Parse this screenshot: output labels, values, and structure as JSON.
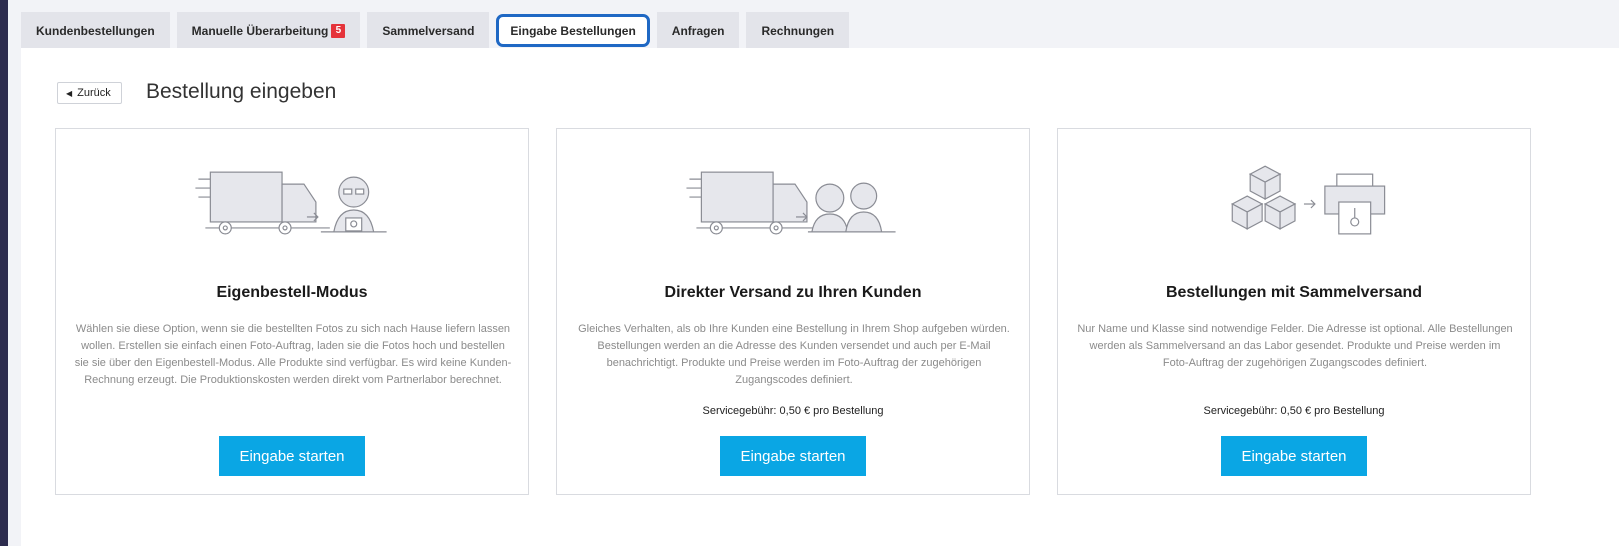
{
  "tabs": [
    {
      "label": "Kundenbestellungen"
    },
    {
      "label": "Manuelle Überarbeitung",
      "badge": "5"
    },
    {
      "label": "Sammelversand"
    },
    {
      "label": "Eingabe Bestellungen"
    },
    {
      "label": "Anfragen"
    },
    {
      "label": "Rechnungen"
    }
  ],
  "active_tab": "Eingabe Bestellungen",
  "back_label": "Zurück",
  "page_title": "Bestellung eingeben",
  "cards": [
    {
      "title": "Eigenbestell-Modus",
      "description": "Wählen sie diese Option, wenn sie die bestellten Fotos zu sich nach Hause liefern lassen wollen. Erstellen sie einfach einen Foto-Auftrag, laden sie die Fotos hoch und bestellen sie sie über den Eigenbestell-Modus. Alle Produkte sind verfügbar. Es wird keine Kunden-Rechnung erzeugt. Die Produktionskosten werden direkt vom Partnerlabor berechnet.",
      "fee": "",
      "button": "Eingabe starten",
      "icon": "truck-to-photographer-icon"
    },
    {
      "title": "Direkter Versand zu Ihren Kunden",
      "description": "Gleiches Verhalten, als ob Ihre Kunden eine Bestellung in Ihrem Shop aufgeben würden. Bestellungen werden an die Adresse des Kunden versendet und auch per E-Mail benachrichtigt. Produkte und Preise werden im Foto-Auftrag der zugehörigen Zugangscodes definiert.",
      "fee": "Servicegebühr: 0,50 € pro Bestellung",
      "button": "Eingabe starten",
      "icon": "truck-to-customers-icon"
    },
    {
      "title": "Bestellungen mit Sammelversand",
      "description": "Nur Name und Klasse sind notwendige Felder. Die Adresse ist optional. Alle Bestellungen werden als Sammelversand an das Labor gesendet. Produkte und Preise werden im Foto-Auftrag der zugehörigen Zugangscodes definiert.",
      "fee": "Servicegebühr: 0,50 € pro Bestellung",
      "button": "Eingabe starten",
      "icon": "boxes-to-printer-icon"
    }
  ],
  "colors": {
    "accent": "#0aa6e4",
    "active_tab_border": "#1f68c4",
    "badge": "#e5333a",
    "sidebar": "#2d2c4e"
  }
}
